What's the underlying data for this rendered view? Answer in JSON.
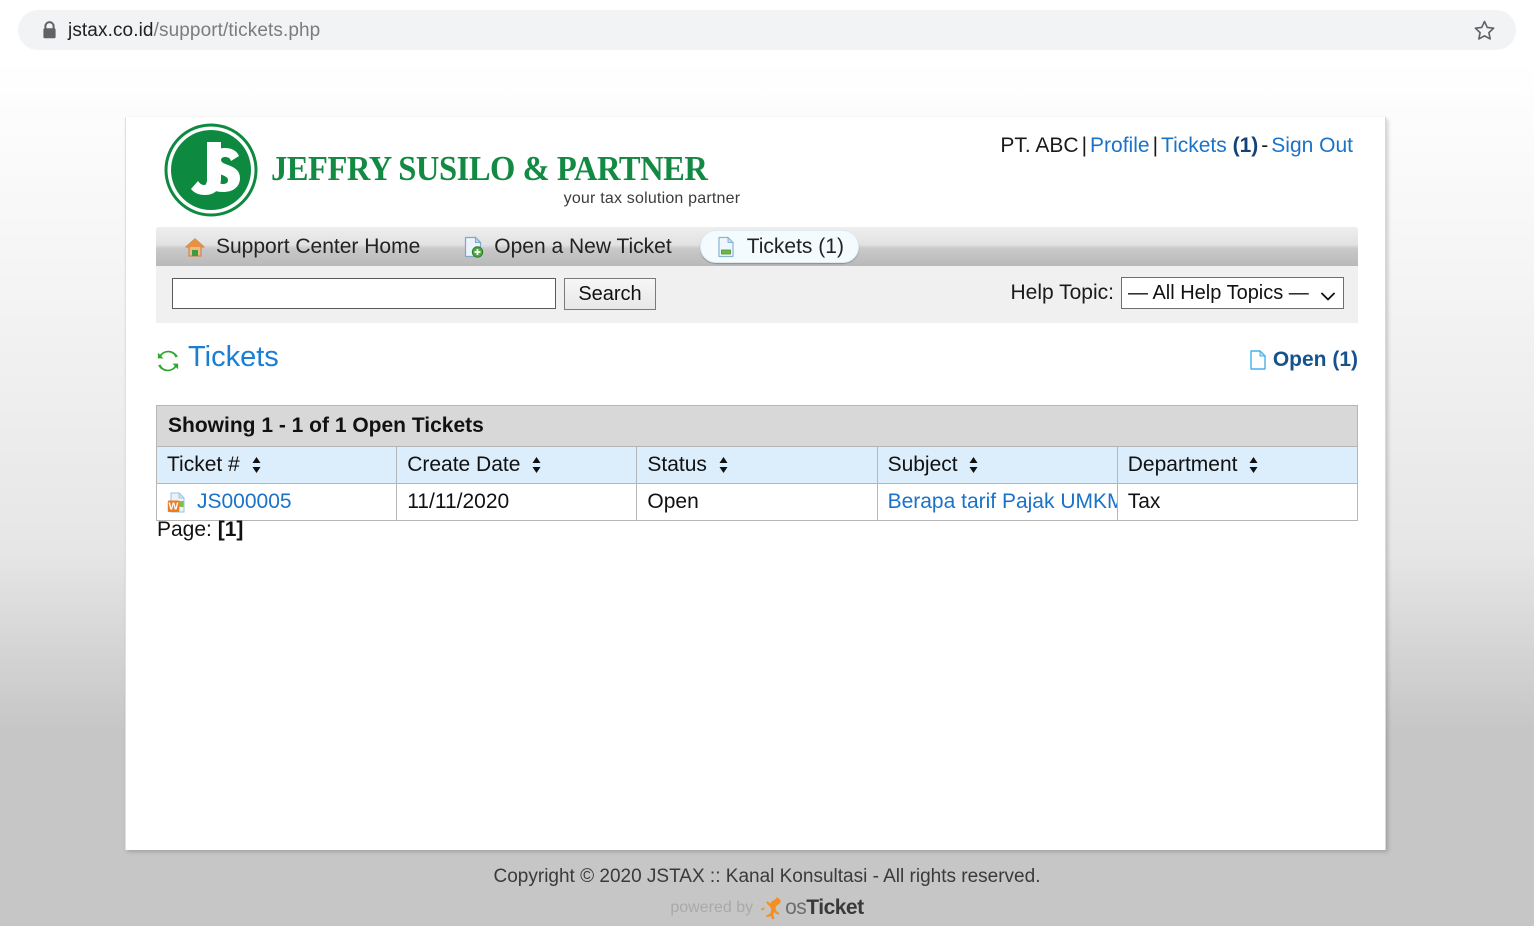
{
  "browser": {
    "url_domain": "jstax.co.id",
    "url_path": "/support/tickets.php",
    "lock_icon": "lock-icon",
    "bookmark_icon": "star-icon"
  },
  "header": {
    "logo_monogram": "JS",
    "logo_name": "JEFFRY SUSILO & PARTNER",
    "logo_tagline": "your tax solution partner",
    "brand_green": "#138a43",
    "user": "PT. ABC",
    "sep1": "|",
    "profile_label": "Profile",
    "sep2": "|",
    "tickets_label": "Tickets",
    "tickets_count": "(1)",
    "sep3": "-",
    "signout_label": "Sign Out",
    "link_blue": "#1a73c9"
  },
  "nav": {
    "items": [
      {
        "label": "Support Center Home",
        "icon": "home-icon",
        "active": false
      },
      {
        "label": "Open a New Ticket",
        "icon": "new-ticket-icon",
        "active": false
      },
      {
        "label": "Tickets (1)",
        "icon": "tickets-page-icon",
        "active": true
      }
    ]
  },
  "filter": {
    "search_value": "",
    "search_placeholder": "",
    "search_button": "Search",
    "help_topic_label": "Help Topic:",
    "help_topic_selected": "— All Help Topics —",
    "help_topic_options": [
      "— All Help Topics —"
    ]
  },
  "content": {
    "title": "Tickets",
    "refresh_icon": "refresh-icon",
    "open_link_label": "Open (1)",
    "open_link_icon": "document-icon",
    "showing_text": "Showing 1 - 1 of 1 Open Tickets",
    "columns": [
      {
        "label": "Ticket #",
        "sortable": true
      },
      {
        "label": "Create Date",
        "sortable": true
      },
      {
        "label": "Status",
        "sortable": true
      },
      {
        "label": "Subject",
        "sortable": true
      },
      {
        "label": "Department",
        "sortable": true
      }
    ],
    "rows": [
      {
        "ticket_number": "JS000005",
        "ticket_icon": "word-document-icon",
        "create_date": "11/11/2020",
        "status": "Open",
        "subject": "Berapa tarif Pajak UMKM saat ini?",
        "department": "Tax"
      }
    ],
    "pager_label": "Page:",
    "pager_current": "[1]"
  },
  "footer": {
    "copyright": "Copyright © 2020 JSTAX :: Kanal Konsultasi - All rights reserved.",
    "powered_by": "powered by",
    "os_text": "os",
    "ticket_text": "Ticket",
    "kangaroo_color": "#f5901f"
  }
}
